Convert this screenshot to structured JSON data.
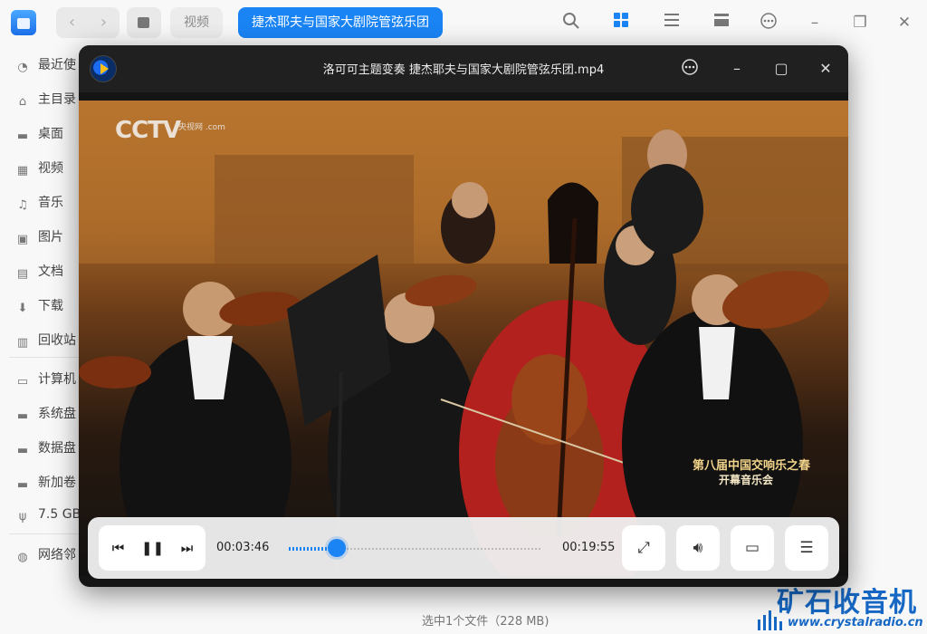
{
  "topbar": {
    "breadcrumb": [
      "视频",
      "捷杰耶夫与国家大剧院管弦乐团"
    ],
    "icons": [
      "back-icon",
      "forward-icon",
      "sidebar-toggle-icon",
      "search-icon",
      "grid-view-icon",
      "list-view-icon",
      "detail-view-icon",
      "more-icon",
      "minimize-icon",
      "restore-icon",
      "close-icon"
    ],
    "accent": "#1a84f5"
  },
  "sidebar": {
    "items": [
      {
        "label": "最近使",
        "icon": "clock-icon"
      },
      {
        "label": "主目录",
        "icon": "home-icon"
      },
      {
        "label": "桌面",
        "icon": "desktop-icon"
      },
      {
        "label": "视频",
        "icon": "video-icon"
      },
      {
        "label": "音乐",
        "icon": "music-icon"
      },
      {
        "label": "图片",
        "icon": "picture-icon"
      },
      {
        "label": "文档",
        "icon": "document-icon"
      },
      {
        "label": "下载",
        "icon": "download-icon"
      },
      {
        "label": "回收站",
        "icon": "trash-icon"
      },
      {
        "label": "计算机",
        "icon": "computer-icon"
      },
      {
        "label": "系统盘",
        "icon": "disk-icon"
      },
      {
        "label": "数据盘",
        "icon": "disk-icon"
      },
      {
        "label": "新加卷",
        "icon": "disk-icon"
      },
      {
        "label": "7.5 GB",
        "icon": "usb-icon"
      },
      {
        "label": "网络邻",
        "icon": "network-icon"
      }
    ]
  },
  "status": {
    "text": "选中1个文件（228 MB)"
  },
  "player": {
    "title": "洛可可主题变奏  捷杰耶夫与国家大剧院管弦乐团.mp4",
    "video": {
      "logo_text": "CCTV",
      "logo_sub": "央视网 .com",
      "caption_line1": "第八届中国交响乐之春",
      "caption_line2": "开幕音乐会"
    },
    "controls": {
      "current_time": "00:03:46",
      "total_time": "00:19:55",
      "progress": 0.19
    }
  },
  "watermark": {
    "title": "矿石收音机",
    "url": "www.crystalradio.cn"
  }
}
